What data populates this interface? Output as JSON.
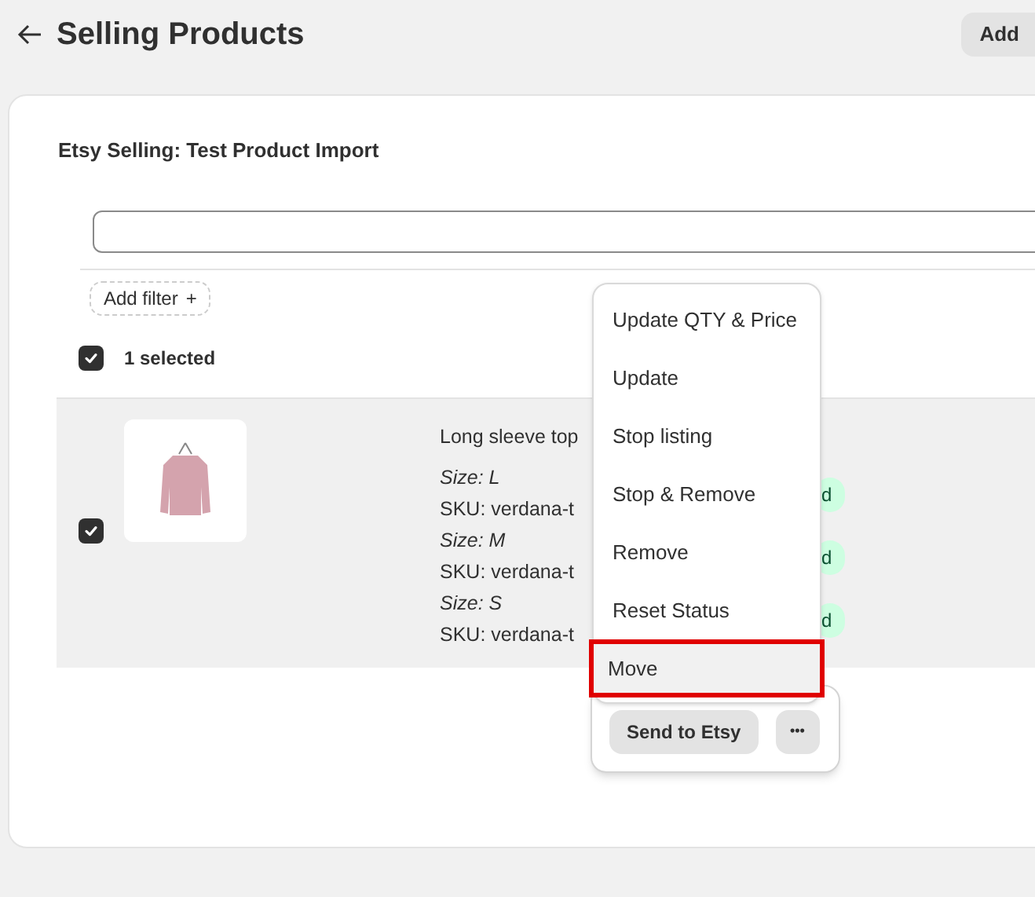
{
  "header": {
    "title": "Selling Products",
    "action": "Add"
  },
  "card": {
    "title": "Etsy Selling: Test Product Import",
    "add_filter": "Add filter",
    "add_filter_icon": "+",
    "selection": {
      "checked": true,
      "label": "1 selected"
    },
    "rows": [
      {
        "checked": true,
        "name": "Long sleeve top",
        "variants": [
          {
            "size_label": "Size:",
            "size": "L",
            "sku": "SKU: verdana-t",
            "status": "d"
          },
          {
            "size_label": "Size:",
            "size": "M",
            "sku": "SKU: verdana-t",
            "status": "d"
          },
          {
            "size_label": "Size:",
            "size": "S",
            "sku": "SKU: verdana-t",
            "status": "d"
          }
        ]
      }
    ]
  },
  "menu": {
    "items": [
      {
        "label": "Update QTY & Price",
        "selected": false
      },
      {
        "label": "Update",
        "selected": false
      },
      {
        "label": "Stop listing",
        "selected": false
      },
      {
        "label": "Stop & Remove",
        "selected": false
      },
      {
        "label": "Remove",
        "selected": false
      },
      {
        "label": "Reset Status",
        "selected": false
      },
      {
        "label": "Move",
        "selected": true
      }
    ]
  },
  "bulk_bar": {
    "primary": "Send to Etsy",
    "more": "•••"
  }
}
